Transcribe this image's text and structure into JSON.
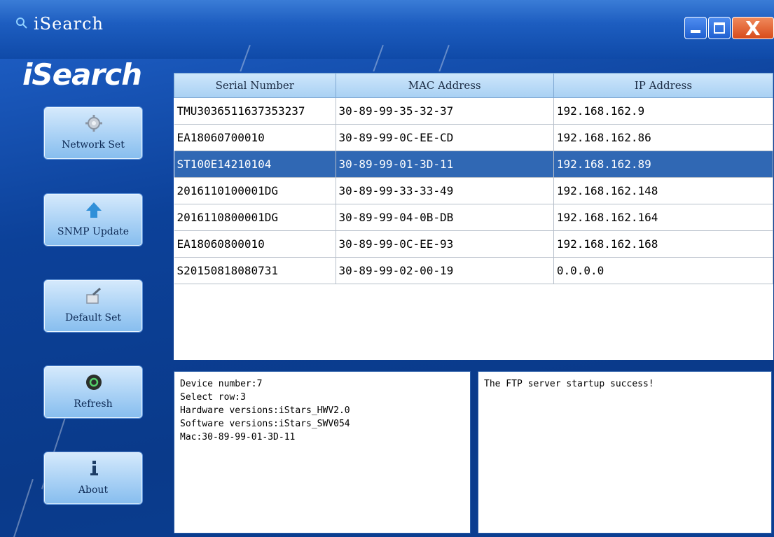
{
  "window": {
    "title": "iSearch",
    "controls": {
      "minimize": "",
      "maximize": "",
      "close": "X"
    }
  },
  "logo": "iSearch",
  "sidebar": {
    "buttons": [
      {
        "label": "Network Set",
        "icon": "gear-icon"
      },
      {
        "label": "SNMP Update",
        "icon": "arrow-up-icon"
      },
      {
        "label": "Default Set",
        "icon": "paint-bucket-icon"
      },
      {
        "label": "Refresh",
        "icon": "refresh-icon"
      },
      {
        "label": "About",
        "icon": "info-icon"
      }
    ]
  },
  "table": {
    "columns": [
      "Serial Number",
      "MAC Address",
      "IP Address"
    ],
    "selected_row": 3,
    "rows": [
      [
        "TMU3036511637353237",
        "30-89-99-35-32-37",
        "192.168.162.9"
      ],
      [
        "EA18060700010",
        "30-89-99-0C-EE-CD",
        "192.168.162.86"
      ],
      [
        "ST100E14210104",
        "30-89-99-01-3D-11",
        "192.168.162.89"
      ],
      [
        "2016110100001DG",
        "30-89-99-33-33-49",
        "192.168.162.148"
      ],
      [
        "2016110800001DG",
        "30-89-99-04-0B-DB",
        "192.168.162.164"
      ],
      [
        "EA18060800010",
        "30-89-99-0C-EE-93",
        "192.168.162.168"
      ],
      [
        "S20150818080731",
        "30-89-99-02-00-19",
        "0.0.0.0"
      ]
    ]
  },
  "info_panel": {
    "lines": [
      "Device number:7",
      "Select row:3",
      "Hardware versions:iStars_HWV2.0",
      "Software versions:iStars_SWV054",
      "Mac:30-89-99-01-3D-11"
    ]
  },
  "log_panel": {
    "lines": [
      "The FTP server startup success!"
    ]
  },
  "colors": {
    "title_bar": "#1d5dc0",
    "background": "#0b3f96",
    "selected_row": "#3068b4",
    "close_button": "#d84b1a",
    "nav_button": "#a9d1f5"
  }
}
